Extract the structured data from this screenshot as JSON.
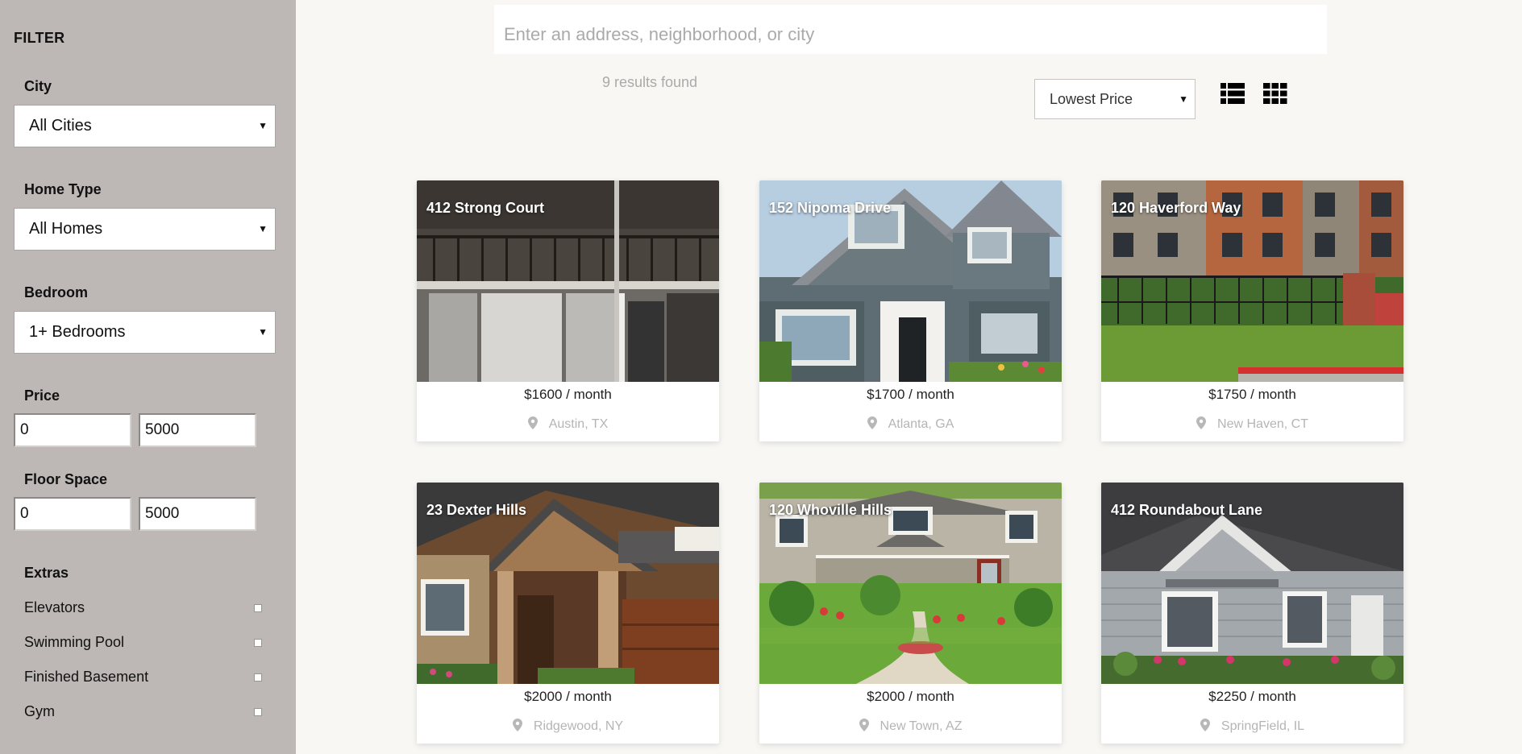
{
  "sidebar": {
    "title": "FILTER",
    "city": {
      "label": "City",
      "value": "All Cities"
    },
    "home_type": {
      "label": "Home Type",
      "value": "All Homes"
    },
    "bedroom": {
      "label": "Bedroom",
      "value": "1+ Bedrooms"
    },
    "price": {
      "label": "Price",
      "min": "0",
      "max": "5000"
    },
    "floor_space": {
      "label": "Floor Space",
      "min": "0",
      "max": "5000"
    },
    "extras": {
      "label": "Extras",
      "items": [
        {
          "label": "Elevators",
          "checked": false
        },
        {
          "label": "Swimming Pool",
          "checked": false
        },
        {
          "label": "Finished Basement",
          "checked": false
        },
        {
          "label": "Gym",
          "checked": false
        }
      ]
    }
  },
  "search": {
    "placeholder": "Enter an address, neighborhood, or city"
  },
  "results": {
    "count_text": "9 results found"
  },
  "sort": {
    "value": "Lowest Price"
  },
  "view_icons": [
    "list-view-icon",
    "grid-view-icon"
  ],
  "listings": [
    {
      "title": "412 Strong Court",
      "price": "$1600 / month",
      "location": "Austin, TX",
      "photo": "apartment-balconies"
    },
    {
      "title": "152 Nipoma Drive",
      "price": "$1700 / month",
      "location": "Atlanta, GA",
      "photo": "blue-gable-house"
    },
    {
      "title": "120 Haverford Way",
      "price": "$1750 / month",
      "location": "New Haven, CT",
      "photo": "brick-apartments"
    },
    {
      "title": "23 Dexter Hills",
      "price": "$2000 / month",
      "location": "Ridgewood, NY",
      "photo": "craftsman-house"
    },
    {
      "title": "120 Whoville Hills",
      "price": "$2000 / month",
      "location": "New Town, AZ",
      "photo": "porch-house-lawn"
    },
    {
      "title": "412 Roundabout Lane",
      "price": "$2250 / month",
      "location": "SpringField, IL",
      "photo": "grey-siding-house"
    }
  ],
  "colors": {
    "sidebar_bg": "#bdb7b5",
    "page_bg": "#f8f7f4",
    "muted_text": "#aaaaaa"
  }
}
